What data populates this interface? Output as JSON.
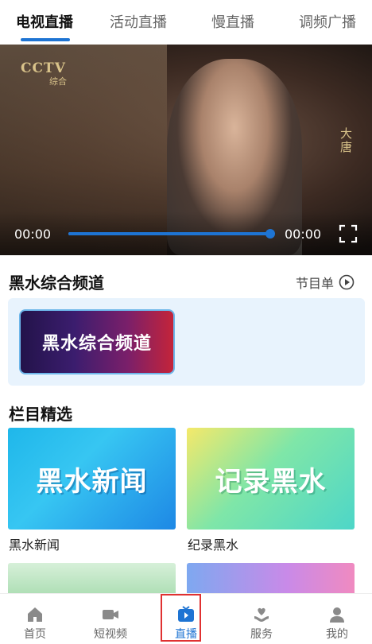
{
  "tabs": [
    {
      "label": "电视直播",
      "active": true
    },
    {
      "label": "活动直播",
      "active": false
    },
    {
      "label": "慢直播",
      "active": false
    },
    {
      "label": "调频广播",
      "active": false
    }
  ],
  "player": {
    "logo_text": "CCTV",
    "logo_sub": "综合",
    "watermark": "大唐",
    "time_current": "00:00",
    "time_total": "00:00",
    "progress": 1.0
  },
  "channel": {
    "title": "黑水综合频道",
    "schedule_label": "节目单",
    "card_label": "黑水综合频道"
  },
  "programs": {
    "title": "栏目精选",
    "items": [
      {
        "image_text": "黑水新闻",
        "label": "黑水新闻"
      },
      {
        "image_text": "记录黑水",
        "label": "纪录黑水"
      }
    ]
  },
  "nav": {
    "items": [
      {
        "label": "首页",
        "icon": "home-icon",
        "active": false
      },
      {
        "label": "短视频",
        "icon": "video-camera-icon",
        "active": false
      },
      {
        "label": "直播",
        "icon": "tv-icon",
        "active": true
      },
      {
        "label": "服务",
        "icon": "heart-hand-icon",
        "active": false
      },
      {
        "label": "我的",
        "icon": "user-icon",
        "active": false
      }
    ]
  },
  "colors": {
    "accent": "#1e74d3",
    "highlight_box": "#e03131",
    "channel_box_bg": "#e8f3fd"
  }
}
